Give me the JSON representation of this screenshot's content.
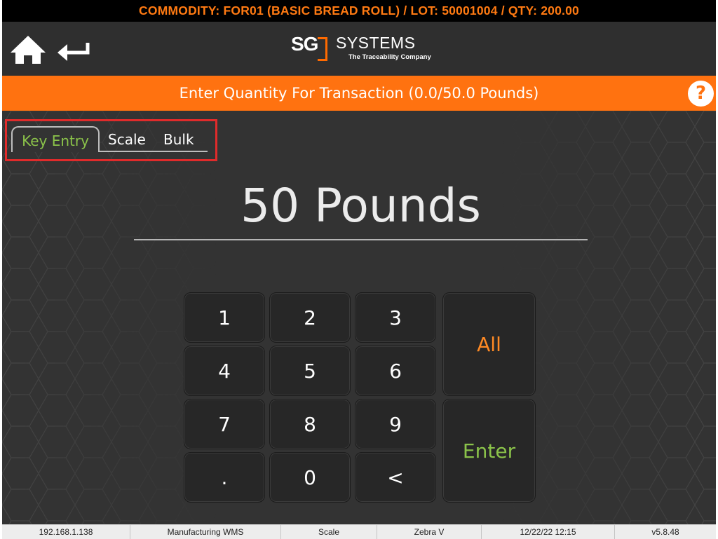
{
  "commodity_bar": {
    "text": "COMMODITY: FOR01 (BASIC BREAD ROLL) / LOT: 50001004 / QTY: 200.00"
  },
  "header": {
    "home_icon": "home-icon",
    "back_icon": "return-arrow-icon",
    "logo": {
      "mark": "SG",
      "name": "SYSTEMS",
      "tagline": "The Traceability Company"
    }
  },
  "title_bar": {
    "text": "Enter Quantity For Transaction (0.0/50.0 Pounds)",
    "help_label": "?"
  },
  "tabs": [
    {
      "label": "Key Entry",
      "active": true
    },
    {
      "label": "Scale",
      "active": false
    },
    {
      "label": "Bulk",
      "active": false
    }
  ],
  "quantity": {
    "value": "50 Pounds"
  },
  "keypad": {
    "k1": "1",
    "k2": "2",
    "k3": "3",
    "k4": "4",
    "k5": "5",
    "k6": "6",
    "k7": "7",
    "k8": "8",
    "k9": "9",
    "kdot": ".",
    "k0": "0",
    "kback": "<",
    "all": "All",
    "enter": "Enter"
  },
  "status_bar": {
    "ip": "192.168.1.138",
    "app": "Manufacturing WMS",
    "device": "Scale",
    "printer": "Zebra V",
    "datetime": "12/22/22 12:15",
    "version": "v5.8.48"
  },
  "colors": {
    "accent_orange": "#ff7210",
    "commodity_text": "#ff7a12",
    "active_tab_green": "#8bc34a",
    "highlight_red": "#e02b2b",
    "background": "#333333"
  }
}
